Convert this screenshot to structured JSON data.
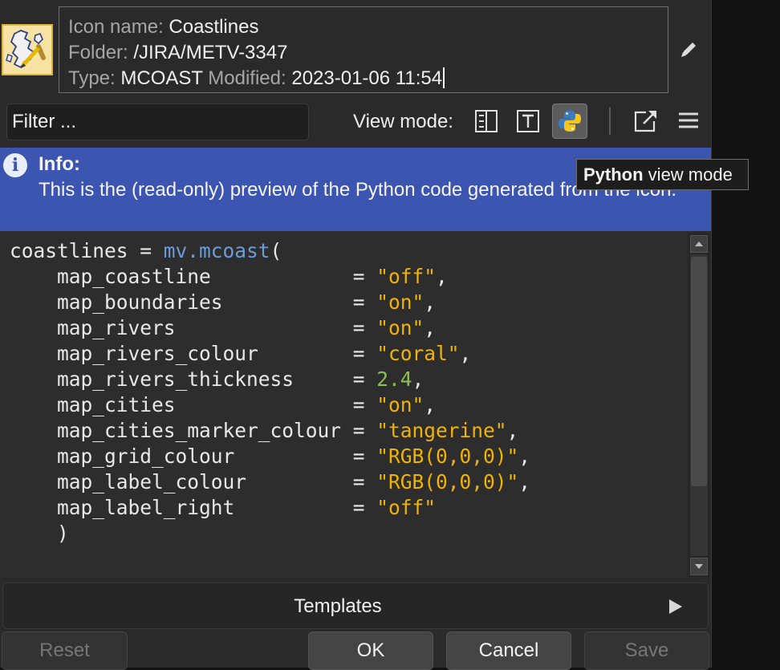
{
  "header": {
    "icon_name_label": "Icon name:",
    "icon_name": "Coastlines",
    "folder_label": "Folder:",
    "folder": "/JIRA/METV-3347",
    "type_label": "Type:",
    "type": "MCOAST",
    "modified_label": "Modified:",
    "modified": "2023-01-06 11:54"
  },
  "toolbar": {
    "filter_placeholder": "Filter ...",
    "view_mode_label": "View mode:",
    "active_view_mode": "python"
  },
  "tooltip": {
    "bold": "Python",
    "rest": " view mode"
  },
  "info": {
    "title": "Info:",
    "message": "This is the (read-only) preview of the Python code generated from the icon."
  },
  "code": {
    "lines": [
      {
        "name": "coastlines",
        "op": " = ",
        "fn": "mv.mcoast",
        "tail": "("
      },
      {
        "name": "    map_coastline            ",
        "op": "= ",
        "value": "\"off\"",
        "kind": "str",
        "tail": ","
      },
      {
        "name": "    map_boundaries           ",
        "op": "= ",
        "value": "\"on\"",
        "kind": "str",
        "tail": ","
      },
      {
        "name": "    map_rivers               ",
        "op": "= ",
        "value": "\"on\"",
        "kind": "str",
        "tail": ","
      },
      {
        "name": "    map_rivers_colour        ",
        "op": "= ",
        "value": "\"coral\"",
        "kind": "str",
        "tail": ","
      },
      {
        "name": "    map_rivers_thickness     ",
        "op": "= ",
        "value": "2.4",
        "kind": "num",
        "tail": ","
      },
      {
        "name": "    map_cities               ",
        "op": "= ",
        "value": "\"on\"",
        "kind": "str",
        "tail": ","
      },
      {
        "name": "    map_cities_marker_colour ",
        "op": "= ",
        "value": "\"tangerine\"",
        "kind": "str",
        "tail": ","
      },
      {
        "name": "    map_grid_colour          ",
        "op": "= ",
        "value": "\"RGB(0,0,0)\"",
        "kind": "str",
        "tail": ","
      },
      {
        "name": "    map_label_colour         ",
        "op": "= ",
        "value": "\"RGB(0,0,0)\"",
        "kind": "str",
        "tail": ","
      },
      {
        "name": "    map_label_right          ",
        "op": "= ",
        "value": "\"off\"",
        "kind": "str",
        "tail": ""
      },
      {
        "name": "    )",
        "op": "",
        "tail": ""
      }
    ]
  },
  "templates": {
    "label": "Templates"
  },
  "buttons": {
    "reset": "Reset",
    "ok": "OK",
    "cancel": "Cancel",
    "save": "Save"
  },
  "colors": {
    "info_bar": "#3b55b0",
    "code_function": "#6d9cd8",
    "code_string": "#f0b400",
    "code_number": "#8bc34a"
  },
  "icons": {
    "header": "coastlines-map-icon",
    "edit": "pencil-icon",
    "view_modes": [
      "tree-view-icon",
      "text-view-icon",
      "python-view-icon"
    ],
    "detach": "open-external-icon",
    "menu": "hamburger-menu-icon",
    "info": "info-icon"
  }
}
